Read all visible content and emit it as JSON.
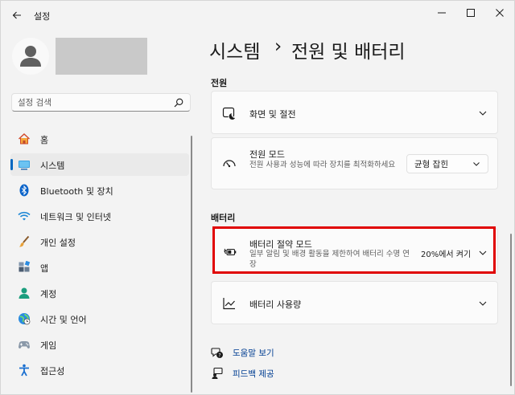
{
  "app": {
    "title": "설정"
  },
  "search": {
    "placeholder": "설정 검색"
  },
  "sidebar": {
    "items": [
      {
        "label": "홈",
        "icon": "home-icon"
      },
      {
        "label": "시스템",
        "icon": "system-icon",
        "selected": true
      },
      {
        "label": "Bluetooth 및 장치",
        "icon": "bluetooth-icon"
      },
      {
        "label": "네트워크 및 인터넷",
        "icon": "wifi-icon"
      },
      {
        "label": "개인 설정",
        "icon": "brush-icon"
      },
      {
        "label": "앱",
        "icon": "apps-icon"
      },
      {
        "label": "계정",
        "icon": "account-icon"
      },
      {
        "label": "시간 및 언어",
        "icon": "globe-icon"
      },
      {
        "label": "게임",
        "icon": "gamepad-icon"
      },
      {
        "label": "접근성",
        "icon": "accessibility-icon"
      }
    ]
  },
  "breadcrumb": {
    "parent": "시스템",
    "separator": "›",
    "current": "전원 및 배터리"
  },
  "power": {
    "section_title": "전원",
    "screen_sleep": {
      "title": "화면 및 절전"
    },
    "power_mode": {
      "title": "전원 모드",
      "description": "전원 사용과 성능에 따라 장치를 최적화하세요",
      "value": "균형 잡힌"
    }
  },
  "battery": {
    "section_title": "배터리",
    "saver": {
      "title": "배터리 절약 모드",
      "description": "일부 알림 및 배경 활동을 제한하여 배터리 수명 연장",
      "status": "20%에서 켜기"
    },
    "usage": {
      "title": "배터리 사용량"
    }
  },
  "links": {
    "help": "도움말 보기",
    "feedback": "피드백 제공"
  },
  "colors": {
    "accent": "#0067c0",
    "highlight": "#e00000",
    "link": "#003e92"
  }
}
